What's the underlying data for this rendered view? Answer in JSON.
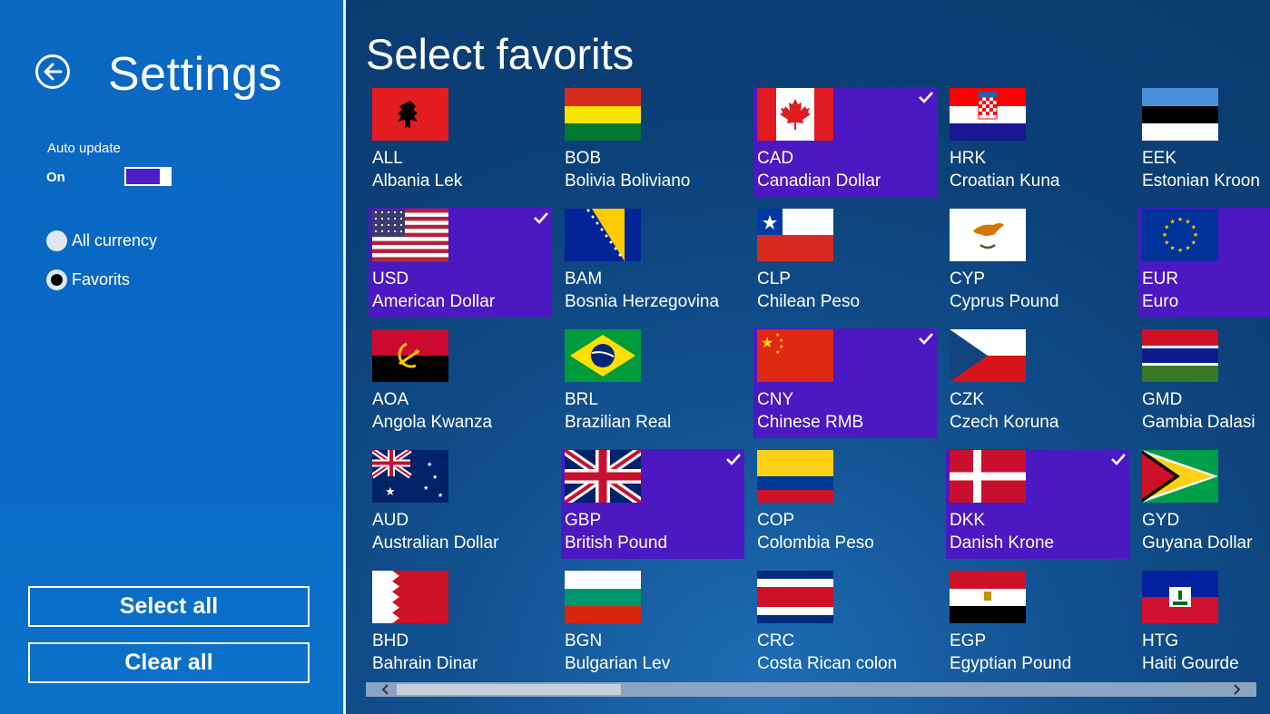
{
  "sidebar": {
    "title": "Settings",
    "auto_update_label": "Auto update",
    "auto_update_state": "On",
    "auto_update_on": true,
    "radio_all": "All currency",
    "radio_favorites": "Favorits",
    "selected_radio": "favorites",
    "select_all": "Select all",
    "clear_all": "Clear all"
  },
  "main": {
    "title": "Select favorits"
  },
  "colors": {
    "accent": "#4c18c2",
    "sidebar": "#0968c4"
  },
  "currencies": [
    {
      "code": "ALL",
      "name": "Albania Lek",
      "fav": false,
      "flag": "albania-flag"
    },
    {
      "code": "BOB",
      "name": "Bolivia Boliviano",
      "fav": false,
      "flag": "bolivia-flag"
    },
    {
      "code": "CAD",
      "name": "Canadian Dollar",
      "fav": true,
      "flag": "canada-flag"
    },
    {
      "code": "HRK",
      "name": "Croatian Kuna",
      "fav": false,
      "flag": "croatia-flag"
    },
    {
      "code": "EEK",
      "name": "Estonian Kroon",
      "fav": false,
      "flag": "estonia-flag"
    },
    {
      "code": "USD",
      "name": "American Dollar",
      "fav": true,
      "flag": "usa-flag"
    },
    {
      "code": "BAM",
      "name": "Bosnia Herzegovina",
      "fav": false,
      "flag": "bosnia-flag"
    },
    {
      "code": "CLP",
      "name": "Chilean Peso",
      "fav": false,
      "flag": "chile-flag"
    },
    {
      "code": "CYP",
      "name": "Cyprus Pound",
      "fav": false,
      "flag": "cyprus-flag"
    },
    {
      "code": "EUR",
      "name": "Euro",
      "fav": true,
      "flag": "eu-flag"
    },
    {
      "code": "AOA",
      "name": "Angola Kwanza",
      "fav": false,
      "flag": "angola-flag"
    },
    {
      "code": "BRL",
      "name": "Brazilian Real",
      "fav": false,
      "flag": "brazil-flag"
    },
    {
      "code": "CNY",
      "name": "Chinese RMB",
      "fav": true,
      "flag": "china-flag"
    },
    {
      "code": "CZK",
      "name": "Czech Koruna",
      "fav": false,
      "flag": "czech-flag"
    },
    {
      "code": "GMD",
      "name": "Gambia Dalasi",
      "fav": false,
      "flag": "gambia-flag"
    },
    {
      "code": "AUD",
      "name": "Australian Dollar",
      "fav": false,
      "flag": "australia-flag"
    },
    {
      "code": "GBP",
      "name": "British Pound",
      "fav": true,
      "flag": "uk-flag"
    },
    {
      "code": "COP",
      "name": "Colombia Peso",
      "fav": false,
      "flag": "colombia-flag"
    },
    {
      "code": "DKK",
      "name": "Danish Krone",
      "fav": true,
      "flag": "denmark-flag"
    },
    {
      "code": "GYD",
      "name": "Guyana Dollar",
      "fav": false,
      "flag": "guyana-flag"
    },
    {
      "code": "BHD",
      "name": "Bahrain Dinar",
      "fav": false,
      "flag": "bahrain-flag"
    },
    {
      "code": "BGN",
      "name": "Bulgarian Lev",
      "fav": false,
      "flag": "bulgaria-flag"
    },
    {
      "code": "CRC",
      "name": "Costa Rican colon",
      "fav": false,
      "flag": "costa-rica-flag"
    },
    {
      "code": "EGP",
      "name": "Egyptian Pound",
      "fav": false,
      "flag": "egypt-flag"
    },
    {
      "code": "HTG",
      "name": "Haiti Gourde",
      "fav": false,
      "flag": "haiti-flag"
    }
  ],
  "scrollbar": {
    "position_fraction": 0.0,
    "visible_fraction": 0.25
  }
}
